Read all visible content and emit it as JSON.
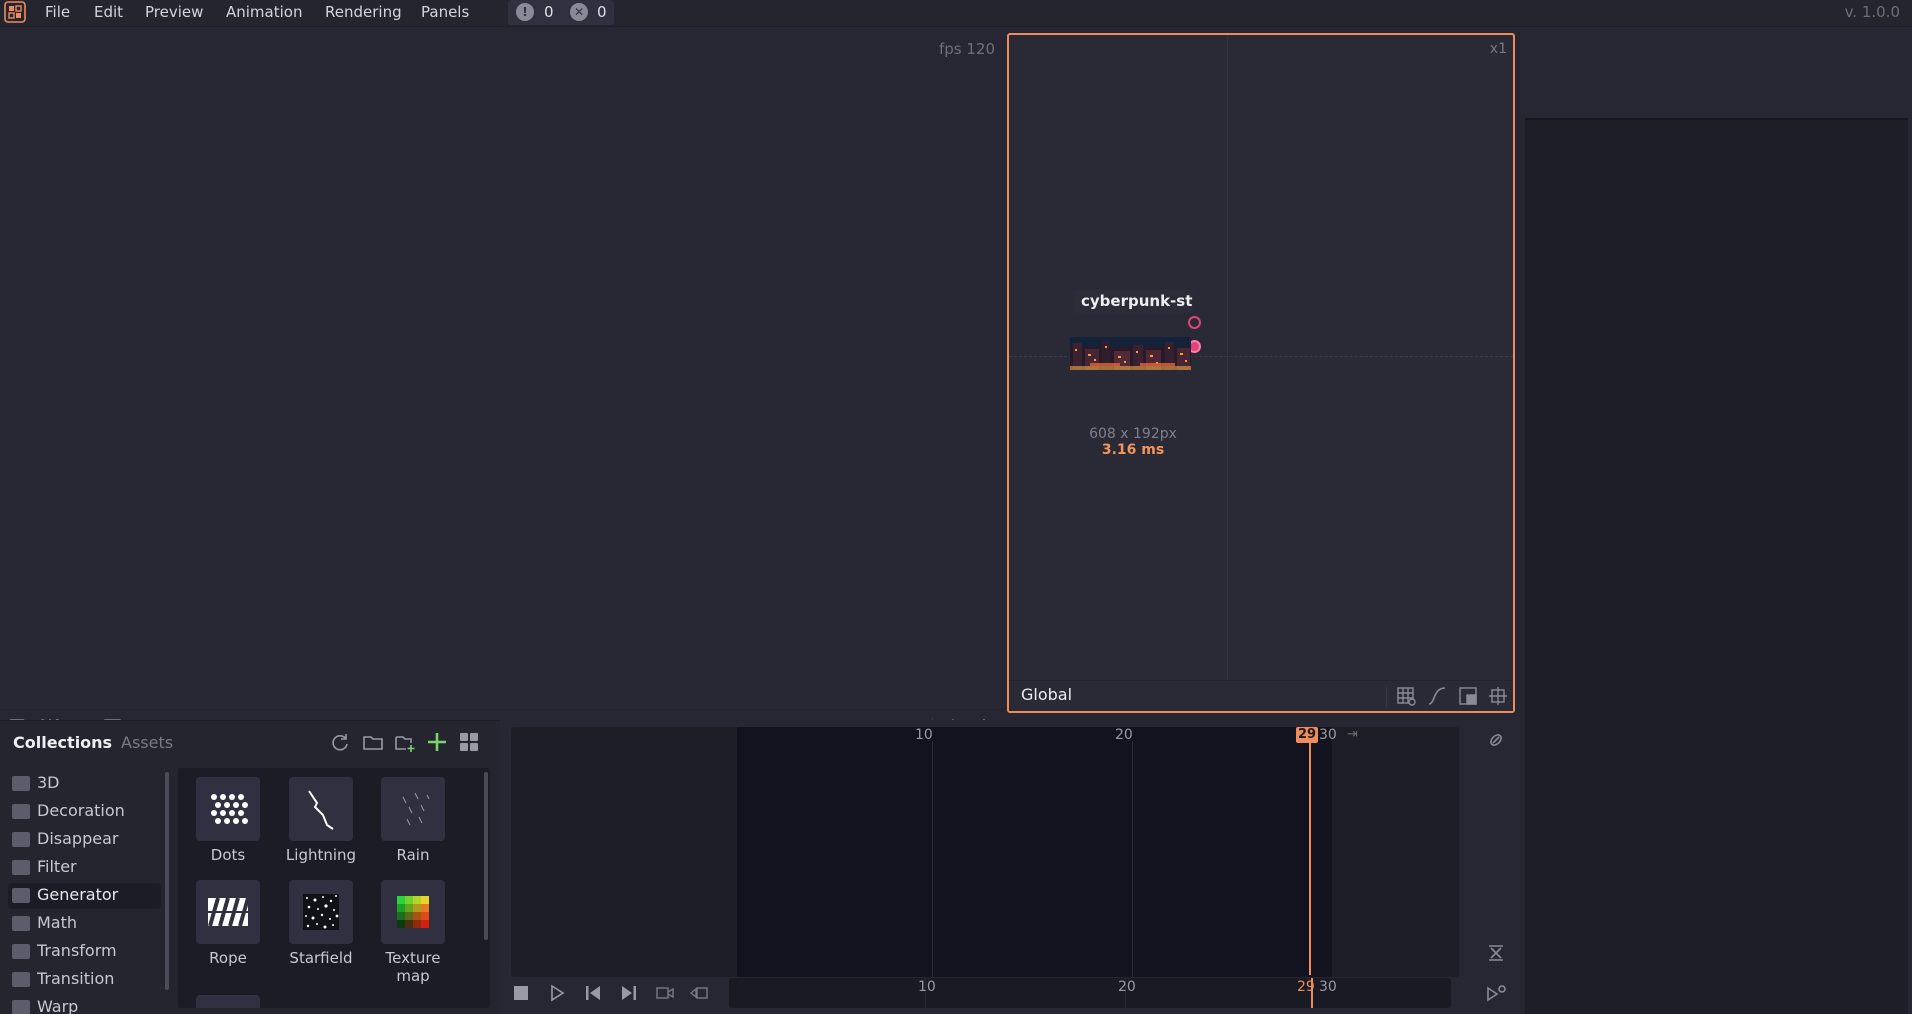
{
  "menubar": {
    "items": [
      "File",
      "Edit",
      "Preview",
      "Animation",
      "Rendering",
      "Panels"
    ],
    "warning_count": "0",
    "error_count": "0",
    "version": "v. 1.0.0"
  },
  "preview": {
    "fps": "fps 120",
    "toolbar_icons": [
      "lock-view-icon",
      "split-view-icon",
      "fit-frame-icon",
      "grid-settings-icon",
      "export-icon",
      "center-icon"
    ]
  },
  "graph": {
    "zoom": "x1",
    "node": {
      "title": "cyberpunk-str...",
      "size": "608 x 192px",
      "time": "3.16 ms"
    },
    "context": "Global",
    "toolbar_icons": [
      "grid-settings-icon",
      "curve-icon",
      "minimap-icon",
      "center-icon"
    ]
  },
  "collections": {
    "tabs": [
      "Collections",
      "Assets"
    ],
    "actions": [
      "refresh-icon",
      "folder-icon",
      "add-folder-icon",
      "add-icon",
      "grid-view-icon"
    ],
    "folders": [
      "3D",
      "Decoration",
      "Disappear",
      "Filter",
      "Generator",
      "Math",
      "Transform",
      "Transition",
      "Warp"
    ],
    "active_folder": "Generator",
    "assets": [
      {
        "label": "Dots",
        "icon": "dots-icon"
      },
      {
        "label": "Lightning",
        "icon": "lightning-icon"
      },
      {
        "label": "Rain",
        "icon": "rain-icon"
      },
      {
        "label": "Rope",
        "icon": "rope-icon"
      },
      {
        "label": "Starfield",
        "icon": "starfield-icon"
      },
      {
        "label": "Texture map",
        "icon": "texture-map-icon"
      }
    ]
  },
  "timeline": {
    "ticks": [
      "10",
      "20",
      "30"
    ],
    "current_frame": "29",
    "end_frame": "30",
    "controls": [
      "stop-icon",
      "play-icon",
      "first-frame-icon",
      "last-frame-icon",
      "record-icon",
      "loop-icon"
    ]
  },
  "colors": {
    "accent": "#f08c5a",
    "junction": "#e0457a",
    "add": "#7bd36b"
  }
}
